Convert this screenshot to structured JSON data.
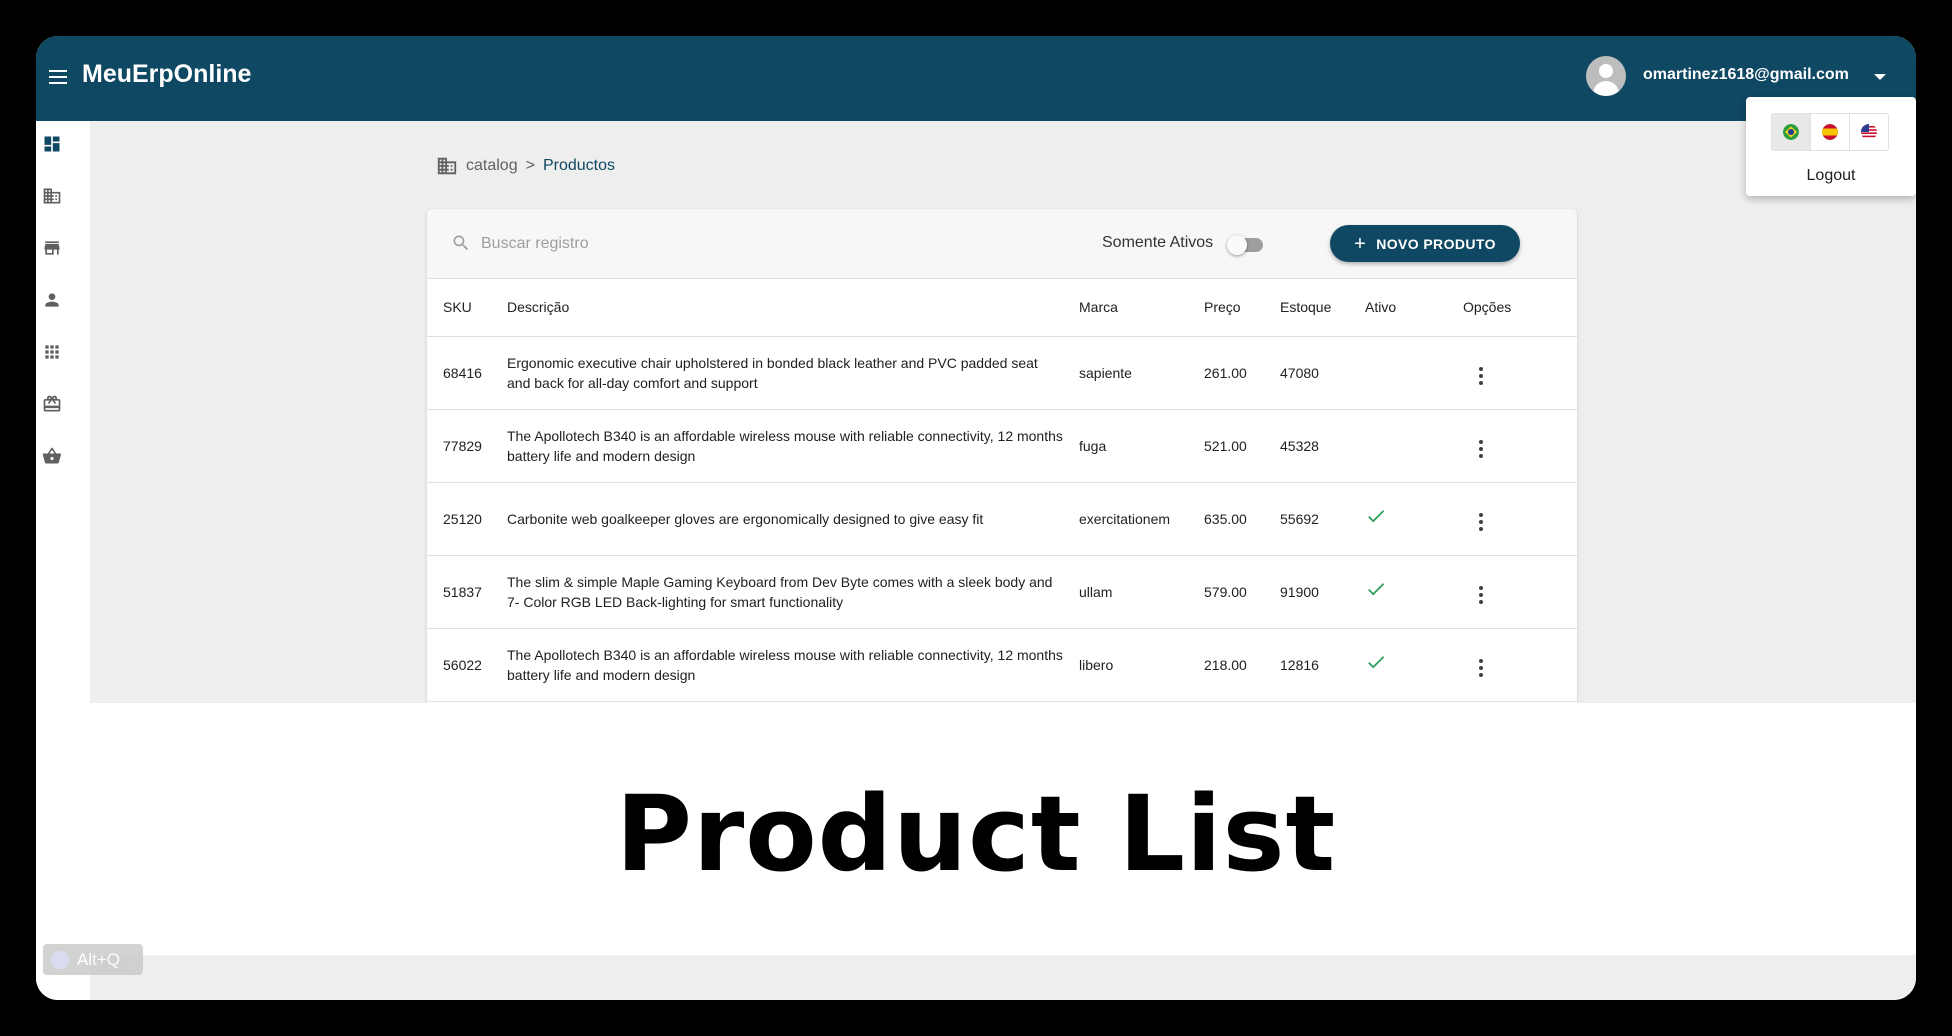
{
  "app": {
    "title": "MeuErpOnline"
  },
  "user": {
    "email": "omartinez1618@gmail.com"
  },
  "sidebar": {
    "items": [
      {
        "icon": "dashboard-icon"
      },
      {
        "icon": "business-icon"
      },
      {
        "icon": "store-icon"
      },
      {
        "icon": "person-icon"
      },
      {
        "icon": "apps-icon"
      },
      {
        "icon": "package-icon"
      },
      {
        "icon": "basket-icon"
      }
    ]
  },
  "breadcrumb": {
    "parent": "catalog",
    "separator": ">",
    "current": "Productos"
  },
  "toolbar": {
    "search_placeholder": "Buscar registro",
    "filter_label": "Somente Ativos",
    "filter_on": false,
    "new_button_label": "NOVO PRODUTO"
  },
  "table": {
    "headers": {
      "sku": "SKU",
      "description": "Descrição",
      "brand": "Marca",
      "price": "Preço",
      "stock": "Estoque",
      "active": "Ativo",
      "options": "Opções"
    },
    "rows": [
      {
        "sku": "68416",
        "description": "Ergonomic executive chair upholstered in bonded black leather and PVC padded seat and back for all-day comfort and support",
        "brand": "sapiente",
        "price": "261.00",
        "stock": "47080",
        "active": false
      },
      {
        "sku": "77829",
        "description": "The Apollotech B340 is an affordable wireless mouse with reliable connectivity, 12 months battery life and modern design",
        "brand": "fuga",
        "price": "521.00",
        "stock": "45328",
        "active": false
      },
      {
        "sku": "25120",
        "description": "Carbonite web goalkeeper gloves are ergonomically designed to give easy fit",
        "brand": "exercitationem",
        "price": "635.00",
        "stock": "55692",
        "active": true
      },
      {
        "sku": "51837",
        "description": "The slim & simple Maple Gaming Keyboard from Dev Byte comes with a sleek body and 7- Color RGB LED Back-lighting for smart functionality",
        "brand": "ullam",
        "price": "579.00",
        "stock": "91900",
        "active": true
      },
      {
        "sku": "56022",
        "description": "The Apollotech B340 is an affordable wireless mouse with reliable connectivity, 12 months battery life and modern design",
        "brand": "libero",
        "price": "218.00",
        "stock": "12816",
        "active": true
      }
    ]
  },
  "language_menu": {
    "languages": [
      {
        "code": "pt-BR",
        "icon": "brazil-flag-icon",
        "selected": true
      },
      {
        "code": "es",
        "icon": "spain-flag-icon",
        "selected": false
      },
      {
        "code": "en-US",
        "icon": "usa-flag-icon",
        "selected": false
      }
    ],
    "logout_label": "Logout"
  },
  "banner": {
    "text": "Product List"
  },
  "shortcut_hint": {
    "text": "Alt+Q"
  },
  "colors": {
    "primary": "#0f4862",
    "success": "#2e9e5b",
    "background": "#eeeeee"
  }
}
